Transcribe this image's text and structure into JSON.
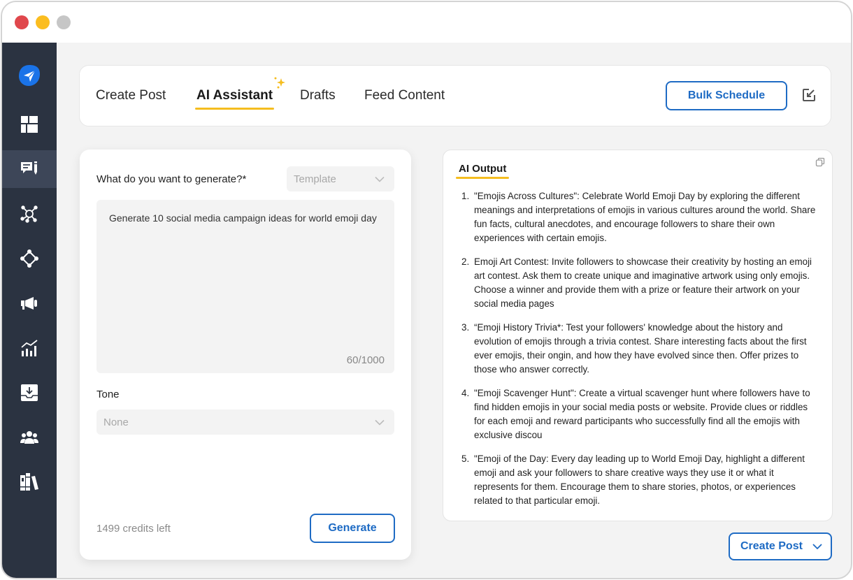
{
  "window": {
    "controls": [
      "close",
      "minimize",
      "maximize"
    ]
  },
  "sidebar": {
    "items": [
      {
        "icon": "paper-plane-logo-icon",
        "active": false
      },
      {
        "icon": "dashboard-grid-icon",
        "active": false
      },
      {
        "icon": "compose-message-icon",
        "active": true
      },
      {
        "icon": "network-hub-icon",
        "active": false
      },
      {
        "icon": "connections-icon",
        "active": false
      },
      {
        "icon": "megaphone-icon",
        "active": false
      },
      {
        "icon": "analytics-chart-icon",
        "active": false
      },
      {
        "icon": "inbox-download-icon",
        "active": false
      },
      {
        "icon": "team-users-icon",
        "active": false
      },
      {
        "icon": "library-books-icon",
        "active": false
      }
    ]
  },
  "tabs": [
    {
      "label": "Create Post",
      "active": false
    },
    {
      "label": "AI Assistant",
      "active": true
    },
    {
      "label": "Drafts",
      "active": false
    },
    {
      "label": "Feed Content",
      "active": false
    }
  ],
  "toolbar": {
    "bulk_schedule_label": "Bulk Schedule"
  },
  "generator": {
    "question_label": "What do you want to generate?*",
    "template_select": {
      "value": "Template"
    },
    "prompt": {
      "value": "Generate 10 social media campaign ideas for world emoji day",
      "count": "60/1000"
    },
    "tone_label": "Tone",
    "tone_select": {
      "value": "None"
    },
    "credits": "1499 credits left",
    "generate_label": "Generate"
  },
  "output": {
    "title": "AI Output",
    "items": [
      {
        "num": "1.",
        "text": "\"Emojis Across Cultures\": Celebrate World Emoji Day by exploring the different meanings and interpretations of emojis in various cultures around the world. Share fun facts, cultural anecdotes, and encourage followers to share their own experiences with certain emojis."
      },
      {
        "num": "2.",
        "text": "Emoji Art Contest: Invite followers to showcase their creativity by hosting an emoji art contest. Ask them to create unique and imaginative artwork using only emojis. Choose a winner and provide them with a prize or feature their artwork on your social media pages"
      },
      {
        "num": "3.",
        "text": "“Emoji History Trivia*: Test your followers' knowledge about the history and evolution of emojis through a trivia contest. Share interesting facts about the first ever emojis, their ongin, and how they have evolved since then. Offer prizes to those who answer correctly."
      },
      {
        "num": "4.",
        "text": "\"Emoji Scavenger Hunt\": Create a virtual scavenger hunt where followers have to find hidden emojis in your social media posts or website. Provide clues or riddles for each emoji and reward participants who successfully find all the emojis with exclusive discou"
      },
      {
        "num": "5.",
        "text": "\"Emoji of the Day: Every day leading up to World Emoji Day, highlight a different emoji and ask your followers to share creative ways they use it or what it represents for them. Encourage them to share stories, photos, or experiences related to that particular emoji."
      }
    ],
    "create_post_label": "Create Post"
  },
  "colors": {
    "accent_blue": "#1e6bc4",
    "highlight_yellow": "#f5bd1f",
    "sidebar_bg": "#2b3341",
    "sidebar_active": "#3d4658"
  }
}
